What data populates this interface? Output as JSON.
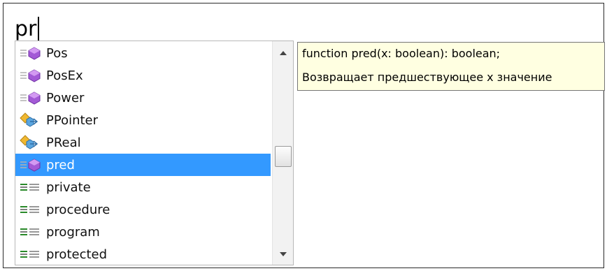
{
  "editor": {
    "typed_text": "pr"
  },
  "completion": {
    "items": [
      {
        "label": "Pos",
        "icon": "function-icon"
      },
      {
        "label": "PosEx",
        "icon": "function-icon"
      },
      {
        "label": "Power",
        "icon": "function-icon"
      },
      {
        "label": "PPointer",
        "icon": "type-icon"
      },
      {
        "label": "PReal",
        "icon": "type-icon"
      },
      {
        "label": "pred",
        "icon": "function-icon",
        "selected": true
      },
      {
        "label": "private",
        "icon": "keyword-icon"
      },
      {
        "label": "procedure",
        "icon": "keyword-icon"
      },
      {
        "label": "program",
        "icon": "keyword-icon"
      },
      {
        "label": "protected",
        "icon": "keyword-icon"
      }
    ],
    "selected_index": 5,
    "selection_color": "#3399ff"
  },
  "tooltip": {
    "signature": "function pred(x: boolean): boolean;",
    "description": "Возвращает предшествующее x значение"
  }
}
